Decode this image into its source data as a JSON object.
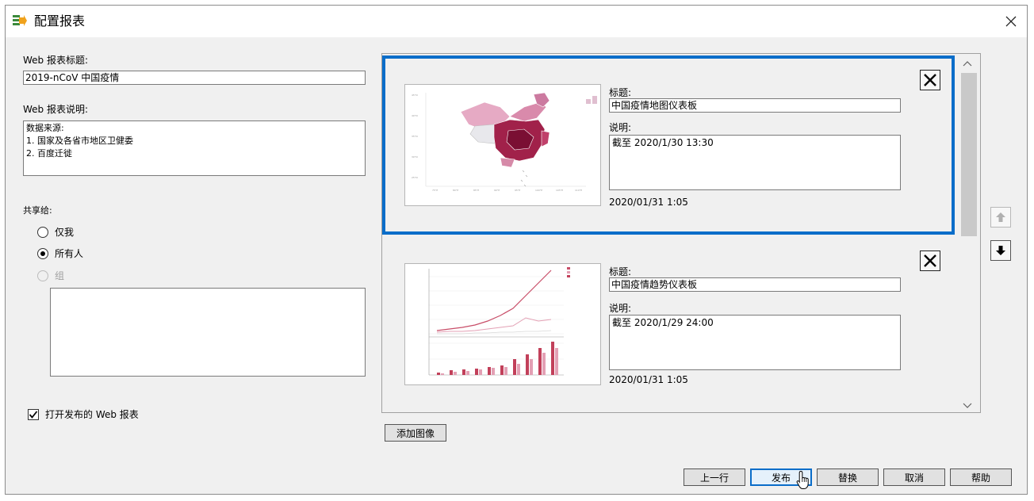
{
  "window": {
    "title": "配置报表"
  },
  "form": {
    "web_title_label": "Web 报表标题:",
    "web_title_value": "2019-nCoV 中国疫情",
    "web_desc_label": "Web 报表说明:",
    "web_desc_value": "数据来源:\n1. 国家及各省市地区卫健委\n2. 百度迁徙",
    "share_label": "共享给:",
    "share_options": [
      {
        "label": "仅我",
        "selected": false,
        "enabled": true
      },
      {
        "label": "所有人",
        "selected": true,
        "enabled": true
      },
      {
        "label": "组",
        "selected": false,
        "enabled": false
      }
    ],
    "open_published_label": "打开发布的 Web 报表",
    "open_published_checked": true
  },
  "items": [
    {
      "title_label": "标题:",
      "title_value": "中国疫情地图仪表板",
      "desc_label": "说明:",
      "desc_value": "截至 2020/1/30 13:30",
      "timestamp": "2020/01/31 1:05",
      "selected": true
    },
    {
      "title_label": "标题:",
      "title_value": "中国疫情趋势仪表板",
      "desc_label": "说明:",
      "desc_value": "截至 2020/1/29 24:00",
      "timestamp": "2020/01/31 1:05",
      "selected": false
    }
  ],
  "buttons": {
    "add_image": "添加图像",
    "previous": "上一行",
    "publish": "发布",
    "replace": "替换",
    "cancel": "取消",
    "help": "帮助"
  },
  "colors": {
    "accent": "#0a6dc9",
    "map_dark": "#8e1238",
    "map_light": "#e8a6c2",
    "bar": "#c2405a",
    "line": "#c84d68"
  }
}
